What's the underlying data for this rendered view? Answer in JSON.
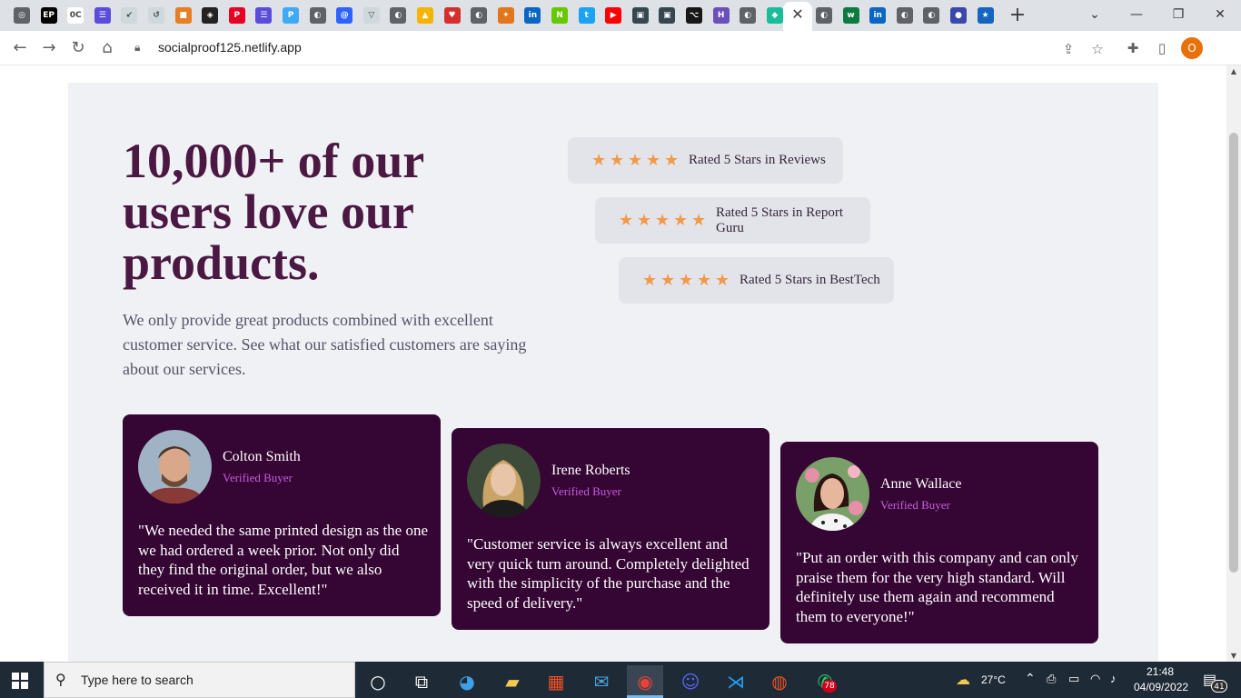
{
  "browser": {
    "url": "socialproof125.netlify.app",
    "profile_initial": "O",
    "tab_favicons": [
      {
        "name": "tab-favicon-1",
        "color": "#5f6368",
        "glyph": "◎"
      },
      {
        "name": "tab-favicon-2",
        "color": "#000000",
        "glyph": "EP"
      },
      {
        "name": "tab-favicon-3",
        "color": "#ffffff",
        "glyph": "0C"
      },
      {
        "name": "tab-favicon-4",
        "color": "#5b4cdb",
        "glyph": "☰"
      },
      {
        "name": "tab-favicon-5",
        "color": "#cfd8dc",
        "glyph": "↙"
      },
      {
        "name": "tab-favicon-6",
        "color": "#cfd8dc",
        "glyph": "↺"
      },
      {
        "name": "tab-favicon-7",
        "color": "#e67e22",
        "glyph": "■"
      },
      {
        "name": "tab-favicon-8",
        "color": "#222222",
        "glyph": "◈"
      },
      {
        "name": "tab-favicon-9",
        "color": "#e60023",
        "glyph": "P"
      },
      {
        "name": "tab-favicon-10",
        "color": "#5b4cdb",
        "glyph": "☰"
      },
      {
        "name": "tab-favicon-11",
        "color": "#3fa9f5",
        "glyph": "P"
      },
      {
        "name": "tab-favicon-12",
        "color": "#5f6368",
        "glyph": "◐"
      },
      {
        "name": "tab-favicon-13",
        "color": "#2d63ff",
        "glyph": "@"
      },
      {
        "name": "tab-favicon-14",
        "color": "#cfd8dc",
        "glyph": "▽"
      },
      {
        "name": "tab-favicon-15",
        "color": "#5f6368",
        "glyph": "◐"
      },
      {
        "name": "tab-favicon-16",
        "color": "#f4b400",
        "glyph": "▲"
      },
      {
        "name": "tab-favicon-17",
        "color": "#d32f2f",
        "glyph": "♥"
      },
      {
        "name": "tab-favicon-18",
        "color": "#5f6368",
        "glyph": "◐"
      },
      {
        "name": "tab-favicon-19",
        "color": "#e2761b",
        "glyph": "✦"
      },
      {
        "name": "tab-favicon-20",
        "color": "#0a66c2",
        "glyph": "in"
      },
      {
        "name": "tab-favicon-21",
        "color": "#65c800",
        "glyph": "N"
      },
      {
        "name": "tab-favicon-22",
        "color": "#1da1f2",
        "glyph": "t"
      },
      {
        "name": "tab-favicon-23",
        "color": "#ff0000",
        "glyph": "▶"
      },
      {
        "name": "tab-favicon-24",
        "color": "#37474f",
        "glyph": "▣"
      },
      {
        "name": "tab-favicon-25",
        "color": "#37474f",
        "glyph": "▣"
      },
      {
        "name": "tab-favicon-26",
        "color": "#181717",
        "glyph": "⌥"
      },
      {
        "name": "tab-favicon-27",
        "color": "#6b4fbb",
        "glyph": "H"
      },
      {
        "name": "tab-favicon-28",
        "color": "#5f6368",
        "glyph": "◐"
      },
      {
        "name": "tab-favicon-29",
        "color": "#1abc9c",
        "glyph": "◆"
      }
    ],
    "tab_favicons_right": [
      {
        "name": "tab-favicon-31",
        "color": "#5f6368",
        "glyph": "◐"
      },
      {
        "name": "tab-favicon-32",
        "color": "#0d7a3e",
        "glyph": "w"
      },
      {
        "name": "tab-favicon-33",
        "color": "#0a66c2",
        "glyph": "in"
      },
      {
        "name": "tab-favicon-34",
        "color": "#5f6368",
        "glyph": "◐"
      },
      {
        "name": "tab-favicon-35",
        "color": "#5f6368",
        "glyph": "◐"
      },
      {
        "name": "tab-favicon-36",
        "color": "#3949ab",
        "glyph": "●"
      },
      {
        "name": "tab-favicon-37",
        "color": "#1565c0",
        "glyph": "★"
      }
    ]
  },
  "page": {
    "headline": "10,000+ of our users love our products.",
    "intro": "We only provide great products combined with excellent customer service. See what our satisfied customers are saying about our services.",
    "ratings": [
      {
        "stars": 5,
        "label": "Rated 5 Stars in Reviews"
      },
      {
        "stars": 5,
        "label": "Rated 5 Stars in Report Guru"
      },
      {
        "stars": 5,
        "label": "Rated 5 Stars in BestTech"
      }
    ],
    "testimonials": [
      {
        "name": "Colton Smith",
        "role": "Verified Buyer",
        "quote": "\"We needed the same printed design as the one we had ordered a week prior. Not only did they find the original order, but we also received it in time. Excellent!\""
      },
      {
        "name": "Irene Roberts",
        "role": "Verified Buyer",
        "quote": "\"Customer service is always excellent and very quick turn around. Completely delighted with the simplicity of the purchase and the speed of delivery.\""
      },
      {
        "name": "Anne Wallace",
        "role": "Verified Buyer",
        "quote": "\"Put an order with this company and can only praise them for the very high standard. Will definitely use them again and recommend them to everyone!\""
      }
    ],
    "colors": {
      "accent": "#4a1842",
      "card": "#350534",
      "star": "#f2994a",
      "role": "#c75de0"
    }
  },
  "taskbar": {
    "search_placeholder": "Type here to search",
    "weather": "27°C",
    "time": "21:48",
    "date": "04/09/2022",
    "whatsapp_badge": "78",
    "notifications": "41"
  }
}
